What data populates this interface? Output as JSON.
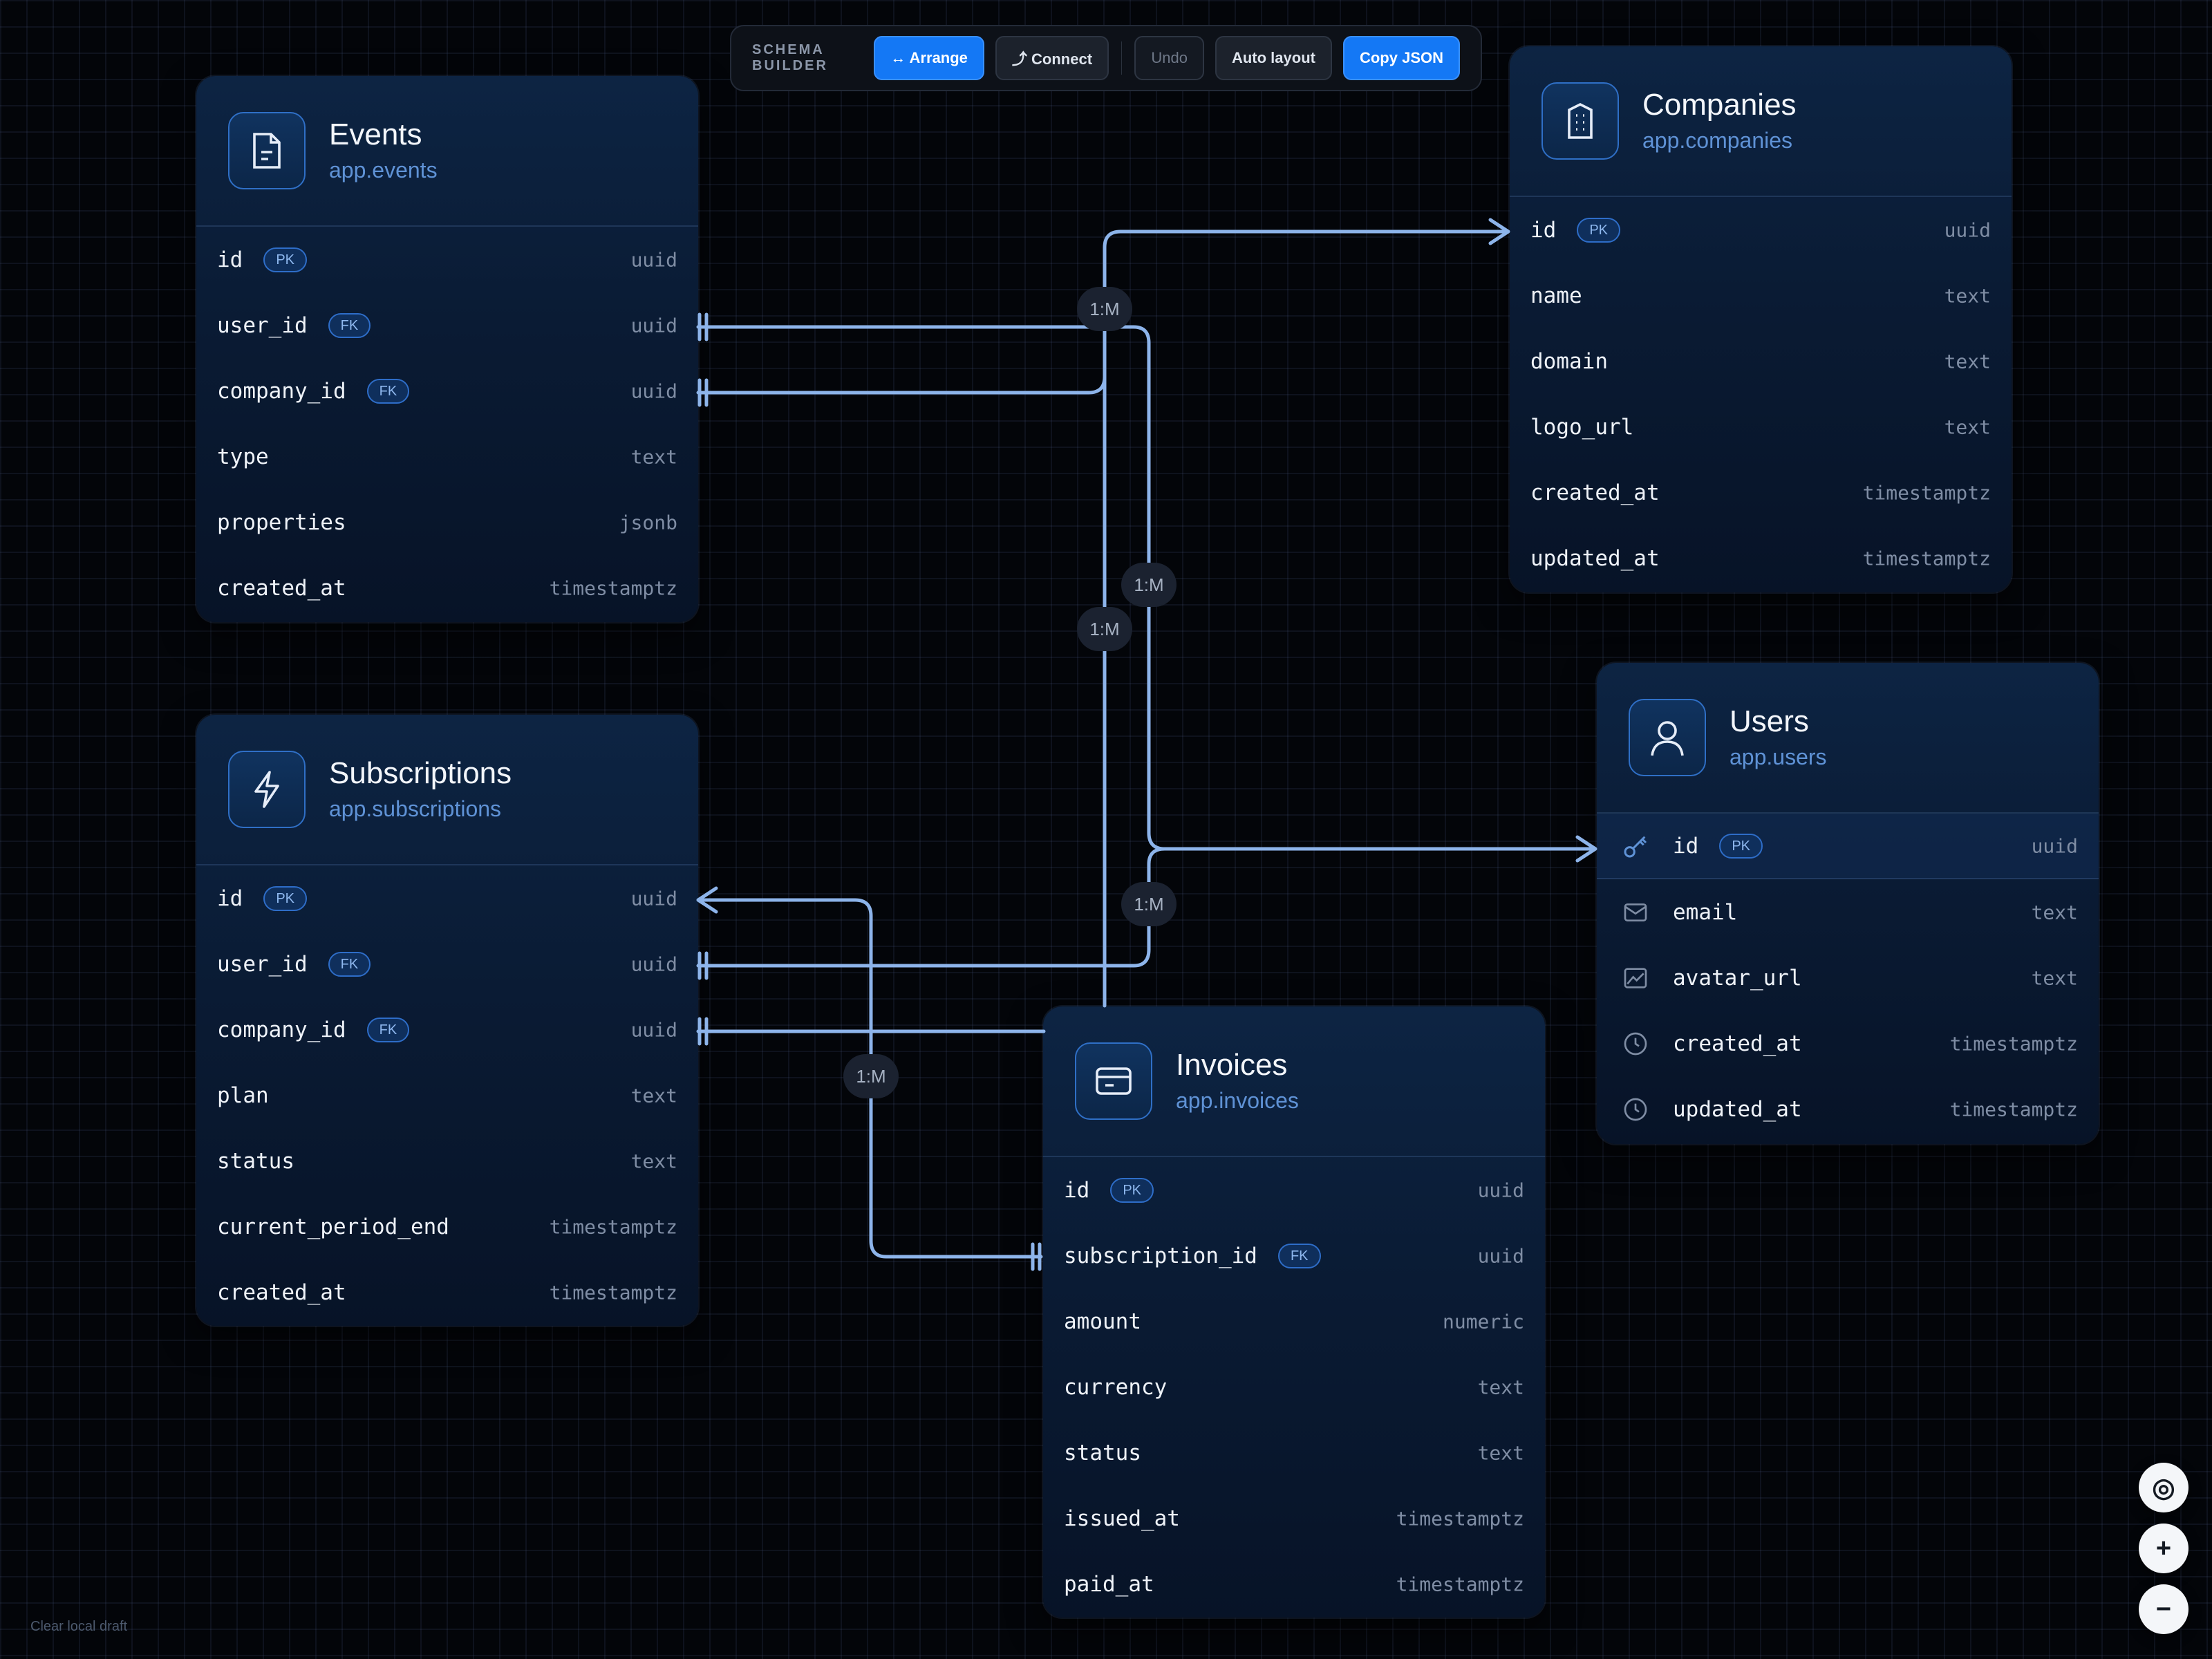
{
  "toolbar": {
    "label": "SCHEMA BUILDER",
    "arrange": "↔ Arrange",
    "connect": "⤴ Connect",
    "undo": "Undo",
    "auto_layout": "Auto layout",
    "copy_json": "Copy JSON"
  },
  "colors": {
    "accent": "#1478f5",
    "link": "#8db4ea",
    "badge": "#2e6dc8",
    "subtitle": "#5f92d6"
  },
  "relation_label": "1:M",
  "tables": {
    "events": {
      "title": "Events",
      "subtitle": "app.events",
      "icon": "document-icon",
      "fields": [
        {
          "name": "id",
          "badge": "PK",
          "type": "uuid"
        },
        {
          "name": "user_id",
          "badge": "FK",
          "type": "uuid"
        },
        {
          "name": "company_id",
          "badge": "FK",
          "type": "uuid"
        },
        {
          "name": "type",
          "badge": "",
          "type": "text"
        },
        {
          "name": "properties",
          "badge": "",
          "type": "jsonb"
        },
        {
          "name": "created_at",
          "badge": "",
          "type": "timestamptz"
        }
      ]
    },
    "companies": {
      "title": "Companies",
      "subtitle": "app.companies",
      "icon": "building-icon",
      "fields": [
        {
          "name": "id",
          "badge": "PK",
          "type": "uuid"
        },
        {
          "name": "name",
          "badge": "",
          "type": "text"
        },
        {
          "name": "domain",
          "badge": "",
          "type": "text"
        },
        {
          "name": "logo_url",
          "badge": "",
          "type": "text"
        },
        {
          "name": "created_at",
          "badge": "",
          "type": "timestamptz"
        },
        {
          "name": "updated_at",
          "badge": "",
          "type": "timestamptz"
        }
      ]
    },
    "subscriptions": {
      "title": "Subscriptions",
      "subtitle": "app.subscriptions",
      "icon": "lightning-icon",
      "fields": [
        {
          "name": "id",
          "badge": "PK",
          "type": "uuid"
        },
        {
          "name": "user_id",
          "badge": "FK",
          "type": "uuid"
        },
        {
          "name": "company_id",
          "badge": "FK",
          "type": "uuid"
        },
        {
          "name": "plan",
          "badge": "",
          "type": "text"
        },
        {
          "name": "status",
          "badge": "",
          "type": "text"
        },
        {
          "name": "current_period_end",
          "badge": "",
          "type": "timestamptz"
        },
        {
          "name": "created_at",
          "badge": "",
          "type": "timestamptz"
        }
      ]
    },
    "users": {
      "title": "Users",
      "subtitle": "app.users",
      "icon": "user-icon",
      "fields": [
        {
          "name": "id",
          "badge": "PK",
          "type": "uuid",
          "icon": "key-icon"
        },
        {
          "name": "email",
          "badge": "",
          "type": "text",
          "icon": "mail-icon"
        },
        {
          "name": "avatar_url",
          "badge": "",
          "type": "text",
          "icon": "image-icon"
        },
        {
          "name": "created_at",
          "badge": "",
          "type": "timestamptz",
          "icon": "clock-icon"
        },
        {
          "name": "updated_at",
          "badge": "",
          "type": "timestamptz",
          "icon": "clock-icon"
        }
      ]
    },
    "invoices": {
      "title": "Invoices",
      "subtitle": "app.invoices",
      "icon": "card-icon",
      "fields": [
        {
          "name": "id",
          "badge": "PK",
          "type": "uuid"
        },
        {
          "name": "subscription_id",
          "badge": "FK",
          "type": "uuid"
        },
        {
          "name": "amount",
          "badge": "",
          "type": "numeric"
        },
        {
          "name": "currency",
          "badge": "",
          "type": "text"
        },
        {
          "name": "status",
          "badge": "",
          "type": "text"
        },
        {
          "name": "issued_at",
          "badge": "",
          "type": "timestamptz"
        },
        {
          "name": "paid_at",
          "badge": "",
          "type": "timestamptz"
        }
      ]
    }
  },
  "zoom": {
    "fit": "◎",
    "in": "+",
    "out": "−"
  },
  "footer": {
    "clear_draft": "Clear local draft"
  }
}
